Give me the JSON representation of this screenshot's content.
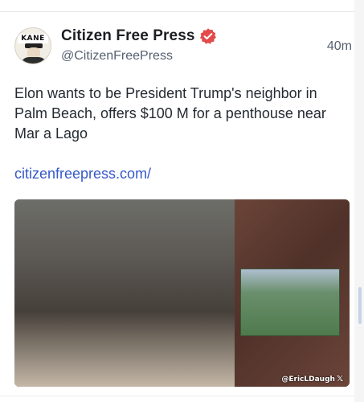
{
  "post": {
    "author_name": "Citizen Free Press",
    "handle": "@CitizenFreePress",
    "time": "40m",
    "text": "Elon wants to be President Trump's neighbor in Palm Beach, offers $100 M for a penthouse near Mar a Lago",
    "link": "citizenfreepress.com/",
    "avatar_text": "KANE",
    "verified_icon": "verified-badge-icon"
  },
  "media": {
    "watermark": "@EricLDaugh",
    "watermark_icon": "x-logo-icon"
  },
  "colors": {
    "link": "#3659c8",
    "verified": "#e34b4b",
    "handle": "#566070"
  }
}
